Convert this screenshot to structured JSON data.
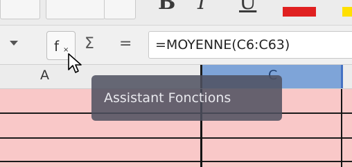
{
  "formula_bar": {
    "fx_label": "f",
    "fx_sub": "×",
    "sum_label": "Σ",
    "equals_label": "=",
    "formula": "=MOYENNE(C6:C63)"
  },
  "columns": {
    "a_label": "A",
    "c_label": "C"
  },
  "tooltip": {
    "text": "Assistant Fonctions"
  },
  "toolbar": {
    "bold_glyph": "B",
    "italic_glyph": "I",
    "underline_glyph": "U",
    "font_color": "#e02020",
    "highlight_color": "#ffe000"
  },
  "colors": {
    "cell_fill": "#f9c8c8",
    "selected_header": "#7ea4d8",
    "tooltip_bg": "#4e5060"
  }
}
